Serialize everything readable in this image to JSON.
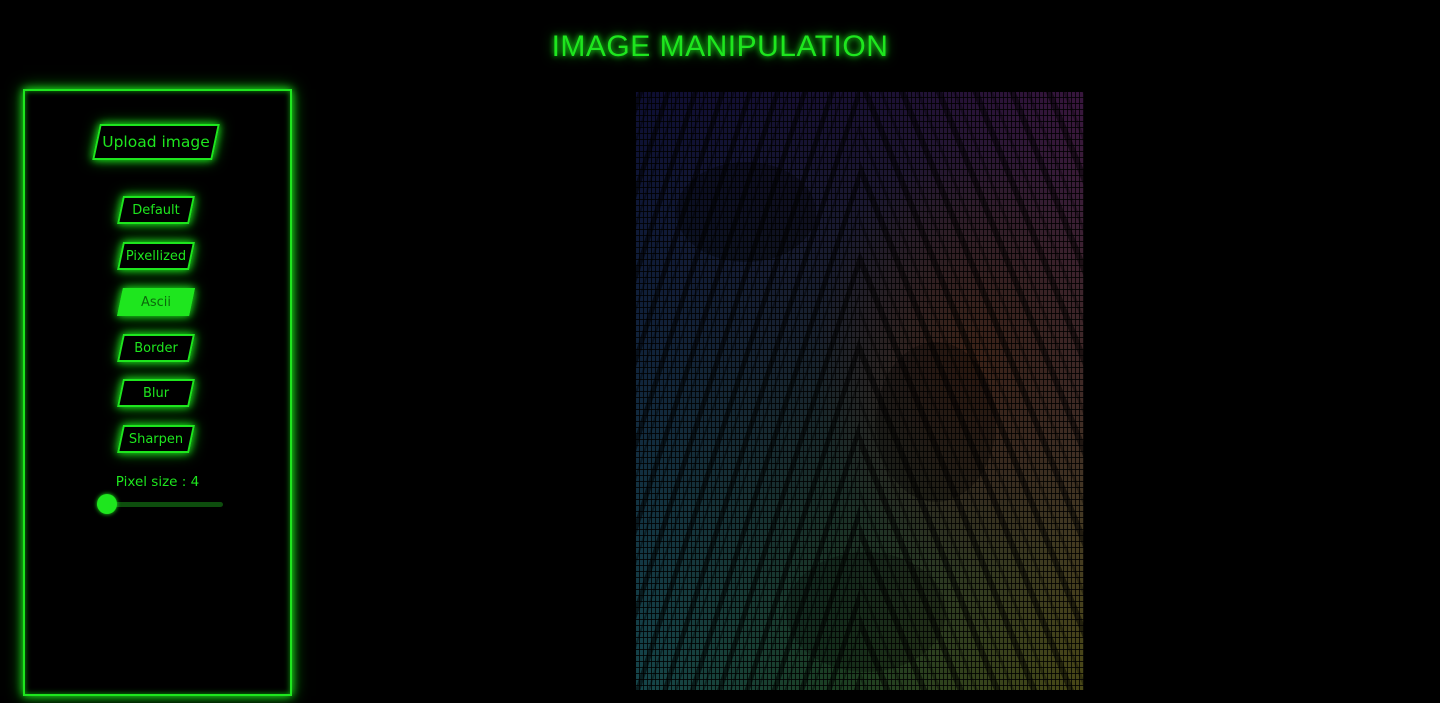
{
  "title": "IMAGE MANIPULATION",
  "sidebar": {
    "upload_label": "Upload image",
    "filters": [
      {
        "label": "Default",
        "active": false
      },
      {
        "label": "Pixellized",
        "active": false
      },
      {
        "label": "Ascii",
        "active": true
      },
      {
        "label": "Border",
        "active": false
      },
      {
        "label": "Blur",
        "active": false
      },
      {
        "label": "Sharpen",
        "active": false
      }
    ],
    "pixel_size_label": "Pixel size : 4",
    "slider": {
      "value": 4,
      "min": 3,
      "max": 40
    }
  },
  "colors": {
    "accent": "#1ee61e",
    "background": "#000000",
    "slider_track": "#0d4d0d"
  },
  "icons": []
}
